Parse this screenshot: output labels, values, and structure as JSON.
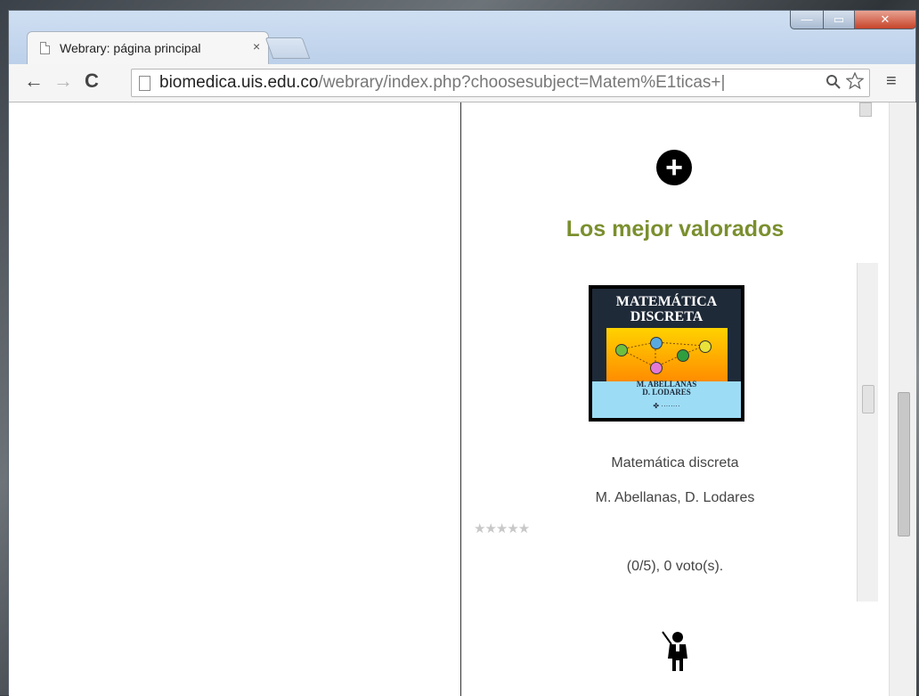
{
  "browser": {
    "tab_title": "Webrary: página principal",
    "tab_close": "×",
    "url_host": "biomedica.uis.edu.co",
    "url_path": "/webrary/index.php?choosesubject=Matem%E1ticas+|",
    "nav": {
      "back": "←",
      "forward": "→",
      "reload": "C"
    },
    "menu": "≡",
    "window_controls": {
      "minimize": "—",
      "maximize": "▭",
      "close": "✕"
    }
  },
  "content": {
    "section_title": "Los mejor valorados",
    "book": {
      "cover_title_line1": "MATEMÁTICA",
      "cover_title_line2": "DISCRETA",
      "cover_authors_line1": "M. ABELLANAS",
      "cover_authors_line2": "D. LODARES",
      "cover_publisher": "✤ ········",
      "title": "Matemática discreta",
      "authors": "M. Abellanas, D. Lodares",
      "rating_stars": "★★★★★",
      "votes_text": "(0/5), 0 voto(s)."
    },
    "icons": {
      "add": "add-circle-icon",
      "teacher": "teacher-icon"
    }
  }
}
